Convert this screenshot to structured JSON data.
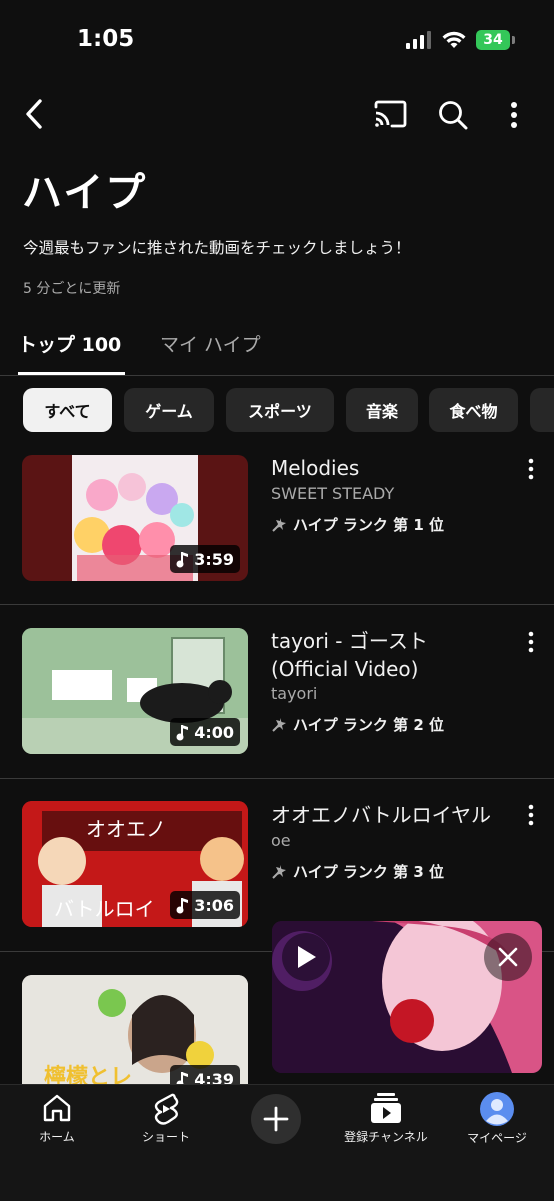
{
  "status_bar": {
    "time": "1:05",
    "battery": "34"
  },
  "header": {
    "title": "ハイプ",
    "description": "今週最もファンに推された動画をチェックしましょう！",
    "update_note": "5 分ごとに更新"
  },
  "tabs": [
    {
      "label": "トップ 100"
    },
    {
      "label": "マイ ハイプ"
    }
  ],
  "chips": [
    {
      "label": "すべて"
    },
    {
      "label": "ゲーム"
    },
    {
      "label": "スポーツ"
    },
    {
      "label": "音楽"
    },
    {
      "label": "食べ物"
    }
  ],
  "videos": [
    {
      "title": "Melodies",
      "channel": "SWEET STEADY",
      "rank": "ハイプ ランク 第 1 位",
      "duration": "3:59"
    },
    {
      "title": "tayori - ゴースト (Official Video)",
      "channel": "tayori",
      "rank": "ハイプ ランク 第 2 位",
      "duration": "4:00"
    },
    {
      "title": "オオエノバトルロイヤル",
      "channel": "oe",
      "rank": "ハイプ ランク 第 3 位",
      "duration": "3:06",
      "thumb_text_top": "オオエノ",
      "thumb_text_bottom": "バトルロイ"
    },
    {
      "title": "",
      "channel": "",
      "rank": "",
      "duration": "4:39",
      "thumb_text": "檸檬とレ"
    }
  ],
  "bottom_nav": [
    {
      "label": "ホーム"
    },
    {
      "label": "ショート"
    },
    {
      "label": ""
    },
    {
      "label": "登録チャンネル"
    },
    {
      "label": "マイページ"
    }
  ]
}
